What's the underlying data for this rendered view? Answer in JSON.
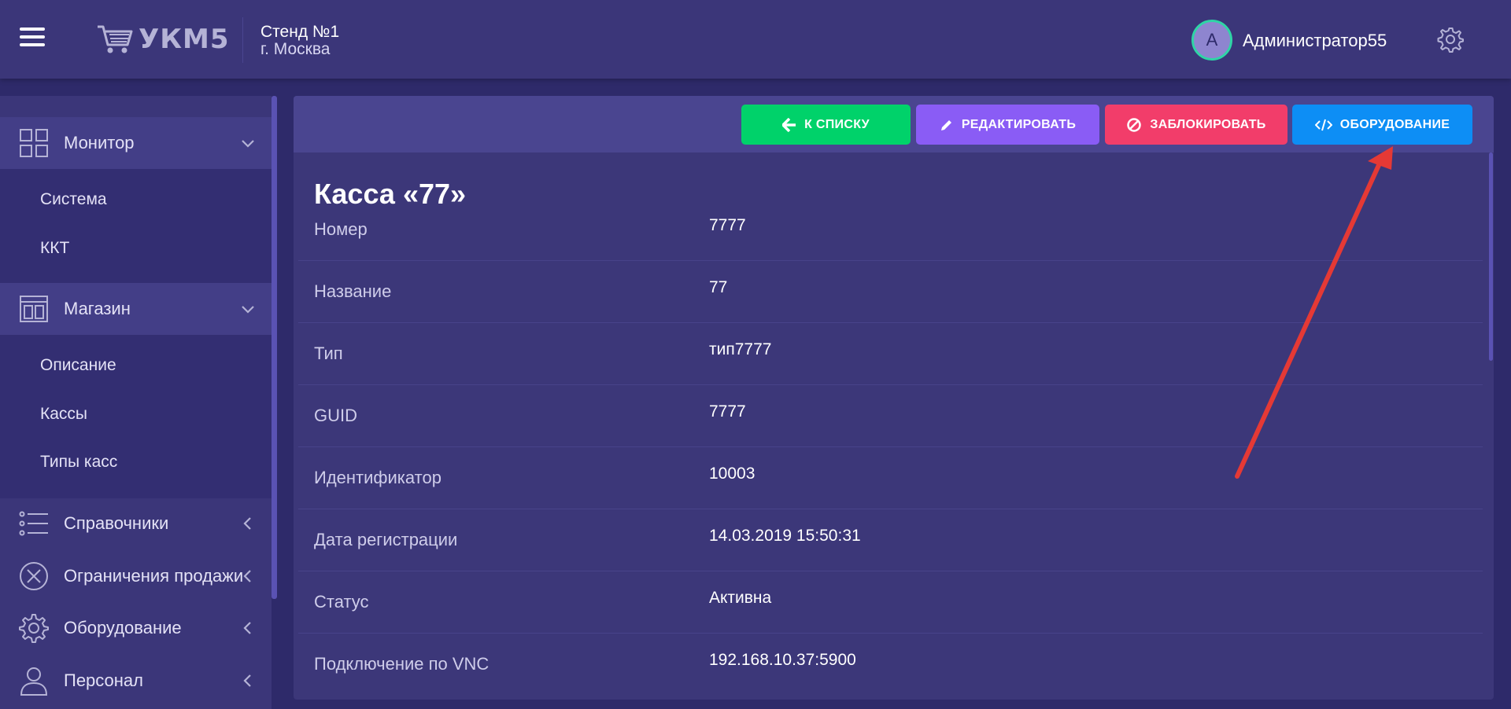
{
  "header": {
    "logo_text": "УКМ5",
    "stand_name": "Стенд №1",
    "stand_city": "г. Москва",
    "avatar_letter": "А",
    "username": "Администратор55"
  },
  "sidebar": {
    "groups": [
      {
        "label": "Монитор",
        "items": [
          "Система",
          "ККТ"
        ]
      },
      {
        "label": "Магазин",
        "items": [
          "Описание",
          "Кассы",
          "Типы касс"
        ]
      },
      {
        "label": "Справочники"
      },
      {
        "label": "Ограничения продажи"
      },
      {
        "label": "Оборудование"
      },
      {
        "label": "Персонал"
      }
    ]
  },
  "toolbar": {
    "back_label": "К СПИСКУ",
    "edit_label": "РЕДАКТИРОВАТЬ",
    "block_label": "ЗАБЛОКИРОВАТЬ",
    "equipment_label": "ОБОРУДОВАНИЕ"
  },
  "card": {
    "title": "Касса «77»",
    "fields": [
      {
        "key": "Номер",
        "value": "7777"
      },
      {
        "key": "Название",
        "value": "77"
      },
      {
        "key": "Тип",
        "value": "тип7777"
      },
      {
        "key": "GUID",
        "value": "7777"
      },
      {
        "key": "Идентификатор",
        "value": "10003"
      },
      {
        "key": "Дата регистрации",
        "value": "14.03.2019 15:50:31"
      },
      {
        "key": "Статус",
        "value": "Активна"
      },
      {
        "key": "Подключение по VNC",
        "value": "192.168.10.37:5900"
      }
    ]
  },
  "colors": {
    "background": "#2e2a6a",
    "header": "#3b3679",
    "btn_back": "#00d26a",
    "btn_edit": "#8a5cf5",
    "btn_block": "#f23d6a",
    "btn_equipment": "#0d8ef5",
    "annotation_arrow": "#e53935",
    "avatar_ring": "#2fd5a6"
  }
}
